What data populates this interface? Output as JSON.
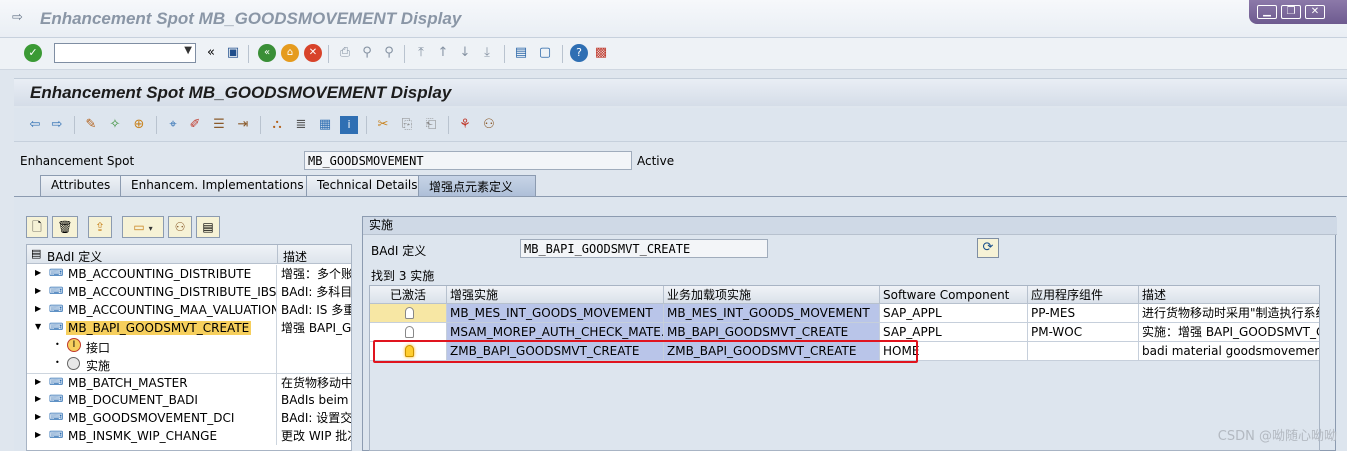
{
  "window": {
    "title": "Enhancement Spot MB_GOODSMOVEMENT Display"
  },
  "screen": {
    "title": "Enhancement Spot MB_GOODSMOVEMENT Display"
  },
  "form": {
    "spot_label": "Enhancement Spot",
    "spot_value": "MB_GOODSMOVEMENT",
    "status": "Active"
  },
  "tabs": [
    "Attributes",
    "Enhancem. Implementations",
    "Technical Details",
    "增强点元素定义"
  ],
  "tree": {
    "col1": "BAdI 定义",
    "col2": "描述",
    "rows": [
      {
        "name": "MB_ACCOUNTING_DISTRIBUTE",
        "desc": "增强：多个账"
      },
      {
        "name": "MB_ACCOUNTING_DISTRIBUTE_IBS",
        "desc": "BAdI: 多科目"
      },
      {
        "name": "MB_ACCOUNTING_MAA_VALUATION",
        "desc": "BAdI: IS 多重"
      },
      {
        "name": "MB_BAPI_GOODSMVT_CREATE",
        "desc": "增强 BAPI_GC"
      },
      {
        "name": "接口",
        "desc": ""
      },
      {
        "name": "实施",
        "desc": ""
      },
      {
        "name": "MB_BATCH_MASTER",
        "desc": "在货物移动中"
      },
      {
        "name": "MB_DOCUMENT_BADI",
        "desc": "BAdIs beim A"
      },
      {
        "name": "MB_GOODSMOVEMENT_DCI",
        "desc": "BAdI: 设置交"
      },
      {
        "name": "MB_INSMK_WIP_CHANGE",
        "desc": "更改 WIP 批次"
      }
    ]
  },
  "right": {
    "title": "实施",
    "badi_label": "BAdI 定义",
    "badi_value": "MB_BAPI_GOODSMVT_CREATE",
    "found": "找到 3  实施",
    "columns": [
      "已激活",
      "增强实施",
      "业务加载项实施",
      "Software Component",
      "应用程序组件",
      "描述"
    ],
    "rows": [
      {
        "active": false,
        "impl": "MB_MES_INT_GOODS_MOVEMENT",
        "biz": "MB_MES_INT_GOODS_MOVEMENT",
        "sc": "SAP_APPL",
        "comp": "PP-MES",
        "desc": "进行货物移动时采用\"制造执行系统"
      },
      {
        "active": false,
        "impl": "MSAM_MOREP_AUTH_CHECK_MATE...",
        "biz": "MB_BAPI_GOODSMVT_CREATE",
        "sc": "SAP_APPL",
        "comp": "PM-WOC",
        "desc": "实施：增强 BAPI_GOODSMVT_C"
      },
      {
        "active": true,
        "impl": "ZMB_BAPI_GOODSMVT_CREATE",
        "biz": "ZMB_BAPI_GOODSMVT_CREATE",
        "sc": "HOME",
        "comp": "",
        "desc": "badi material goodsmovement cr"
      }
    ]
  },
  "watermark": "CSDN @呦随心呦呦"
}
